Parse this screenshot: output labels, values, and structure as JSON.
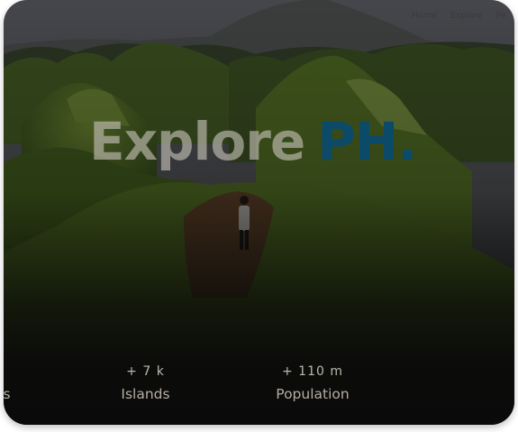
{
  "nav": {
    "items": [
      "Home",
      "Explore",
      "Fe"
    ]
  },
  "hero": {
    "title_part1": "Explore",
    "title_part2": "PH."
  },
  "stats": [
    {
      "value": "",
      "label": "es"
    },
    {
      "value": "+ 7 k",
      "label": "Islands"
    },
    {
      "value": "+ 110 m",
      "label": "Population"
    }
  ],
  "colors": {
    "accent": "#0c4a6a",
    "overlay": "#0a0a0a"
  }
}
